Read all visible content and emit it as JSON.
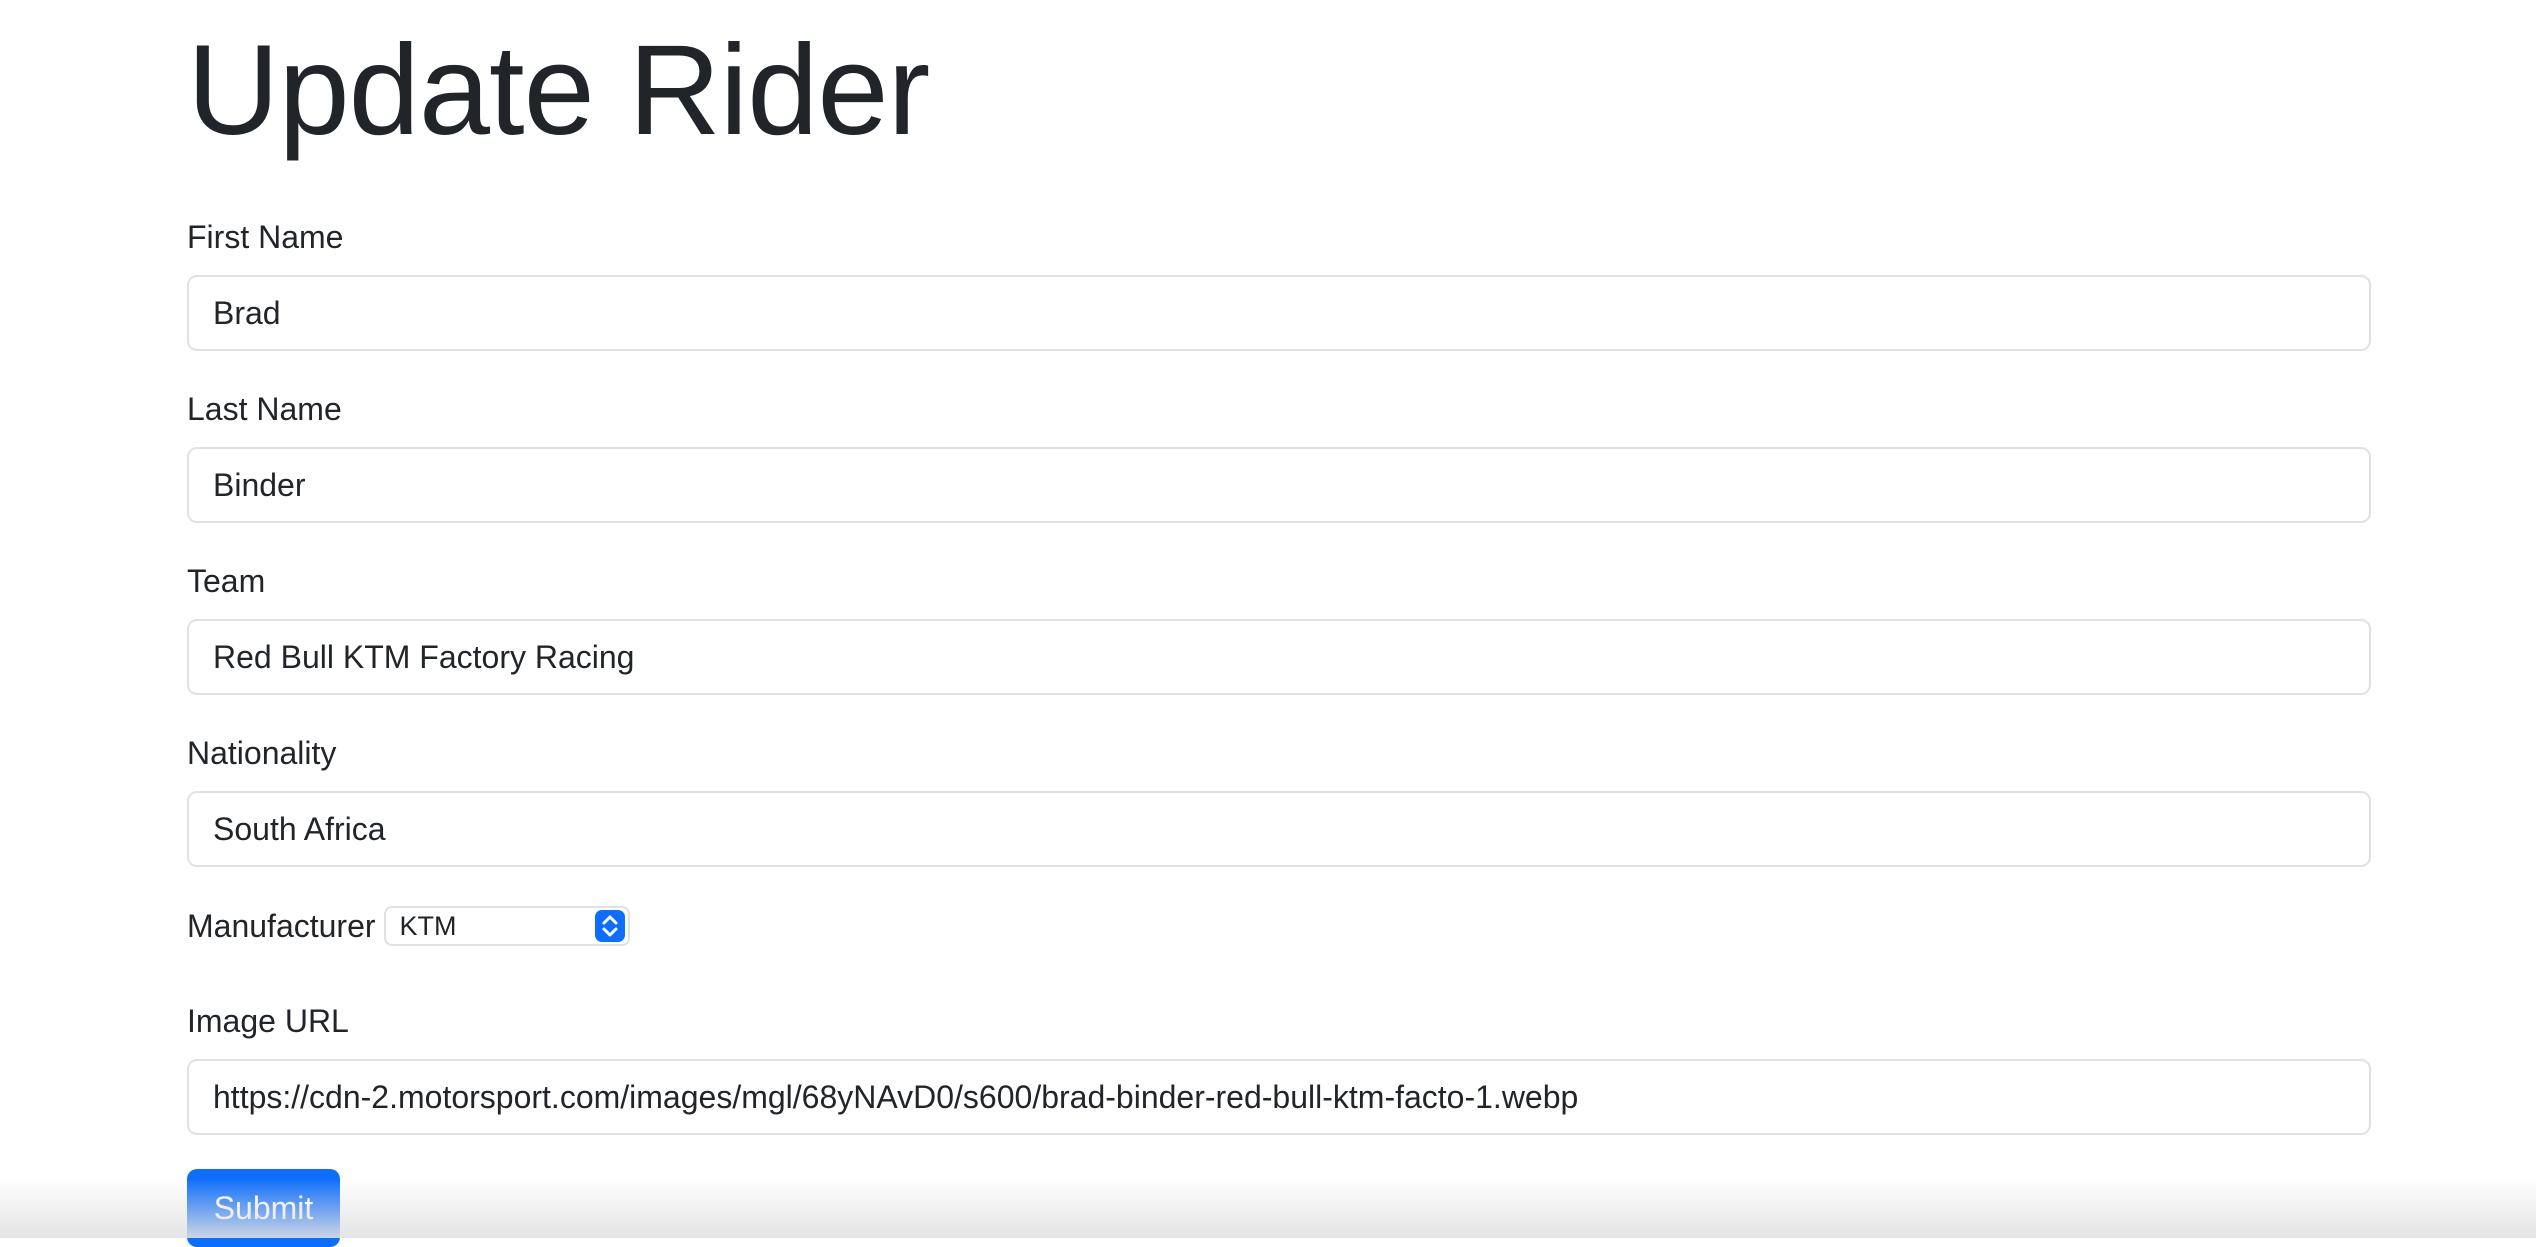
{
  "page": {
    "title": "Update Rider"
  },
  "form": {
    "first_name": {
      "label": "First Name",
      "value": "Brad"
    },
    "last_name": {
      "label": "Last Name",
      "value": "Binder"
    },
    "team": {
      "label": "Team",
      "value": "Red Bull KTM Factory Racing"
    },
    "nationality": {
      "label": "Nationality",
      "value": "South Africa"
    },
    "manufacturer": {
      "label": "Manufacturer",
      "selected": "KTM"
    },
    "image_url": {
      "label": "Image URL",
      "value": "https://cdn-2.motorsport.com/images/mgl/68yNAvD0/s600/brad-binder-red-bull-ktm-facto-1.webp"
    },
    "submit_label": "Submit"
  },
  "colors": {
    "primary": "#0d6efd",
    "text": "#212529",
    "input_border": "#dee2e6"
  },
  "icons": {
    "select_arrows": "chevron-up-down-icon"
  }
}
